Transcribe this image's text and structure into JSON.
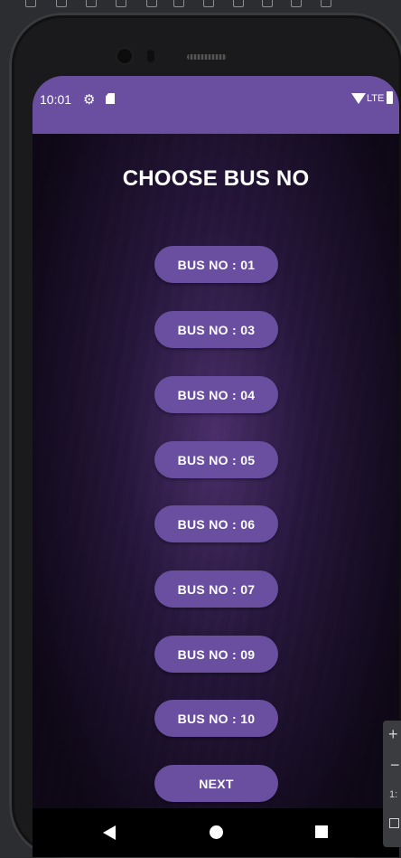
{
  "status_bar": {
    "time": "10:01",
    "network": "LTE",
    "icons": [
      "settings-icon",
      "sd-card-icon",
      "wifi-icon",
      "battery-icon"
    ]
  },
  "app": {
    "title": "CHOOSE BUS NO",
    "accent_color": "#6a4fa0",
    "buttons": [
      {
        "label": "BUS NO : 01"
      },
      {
        "label": "BUS NO : 03"
      },
      {
        "label": "BUS NO : 04"
      },
      {
        "label": "BUS NO : 05"
      },
      {
        "label": "BUS NO : 06"
      },
      {
        "label": "BUS NO : 07"
      },
      {
        "label": "BUS NO : 09"
      },
      {
        "label": "BUS NO : 10"
      }
    ],
    "next_label": "NEXT"
  },
  "navigation": {
    "icons": [
      "back-icon",
      "home-icon",
      "recents-icon"
    ]
  },
  "emulator_panel": {
    "zoom_in": "+",
    "zoom_out": "−",
    "ratio": "1:"
  }
}
